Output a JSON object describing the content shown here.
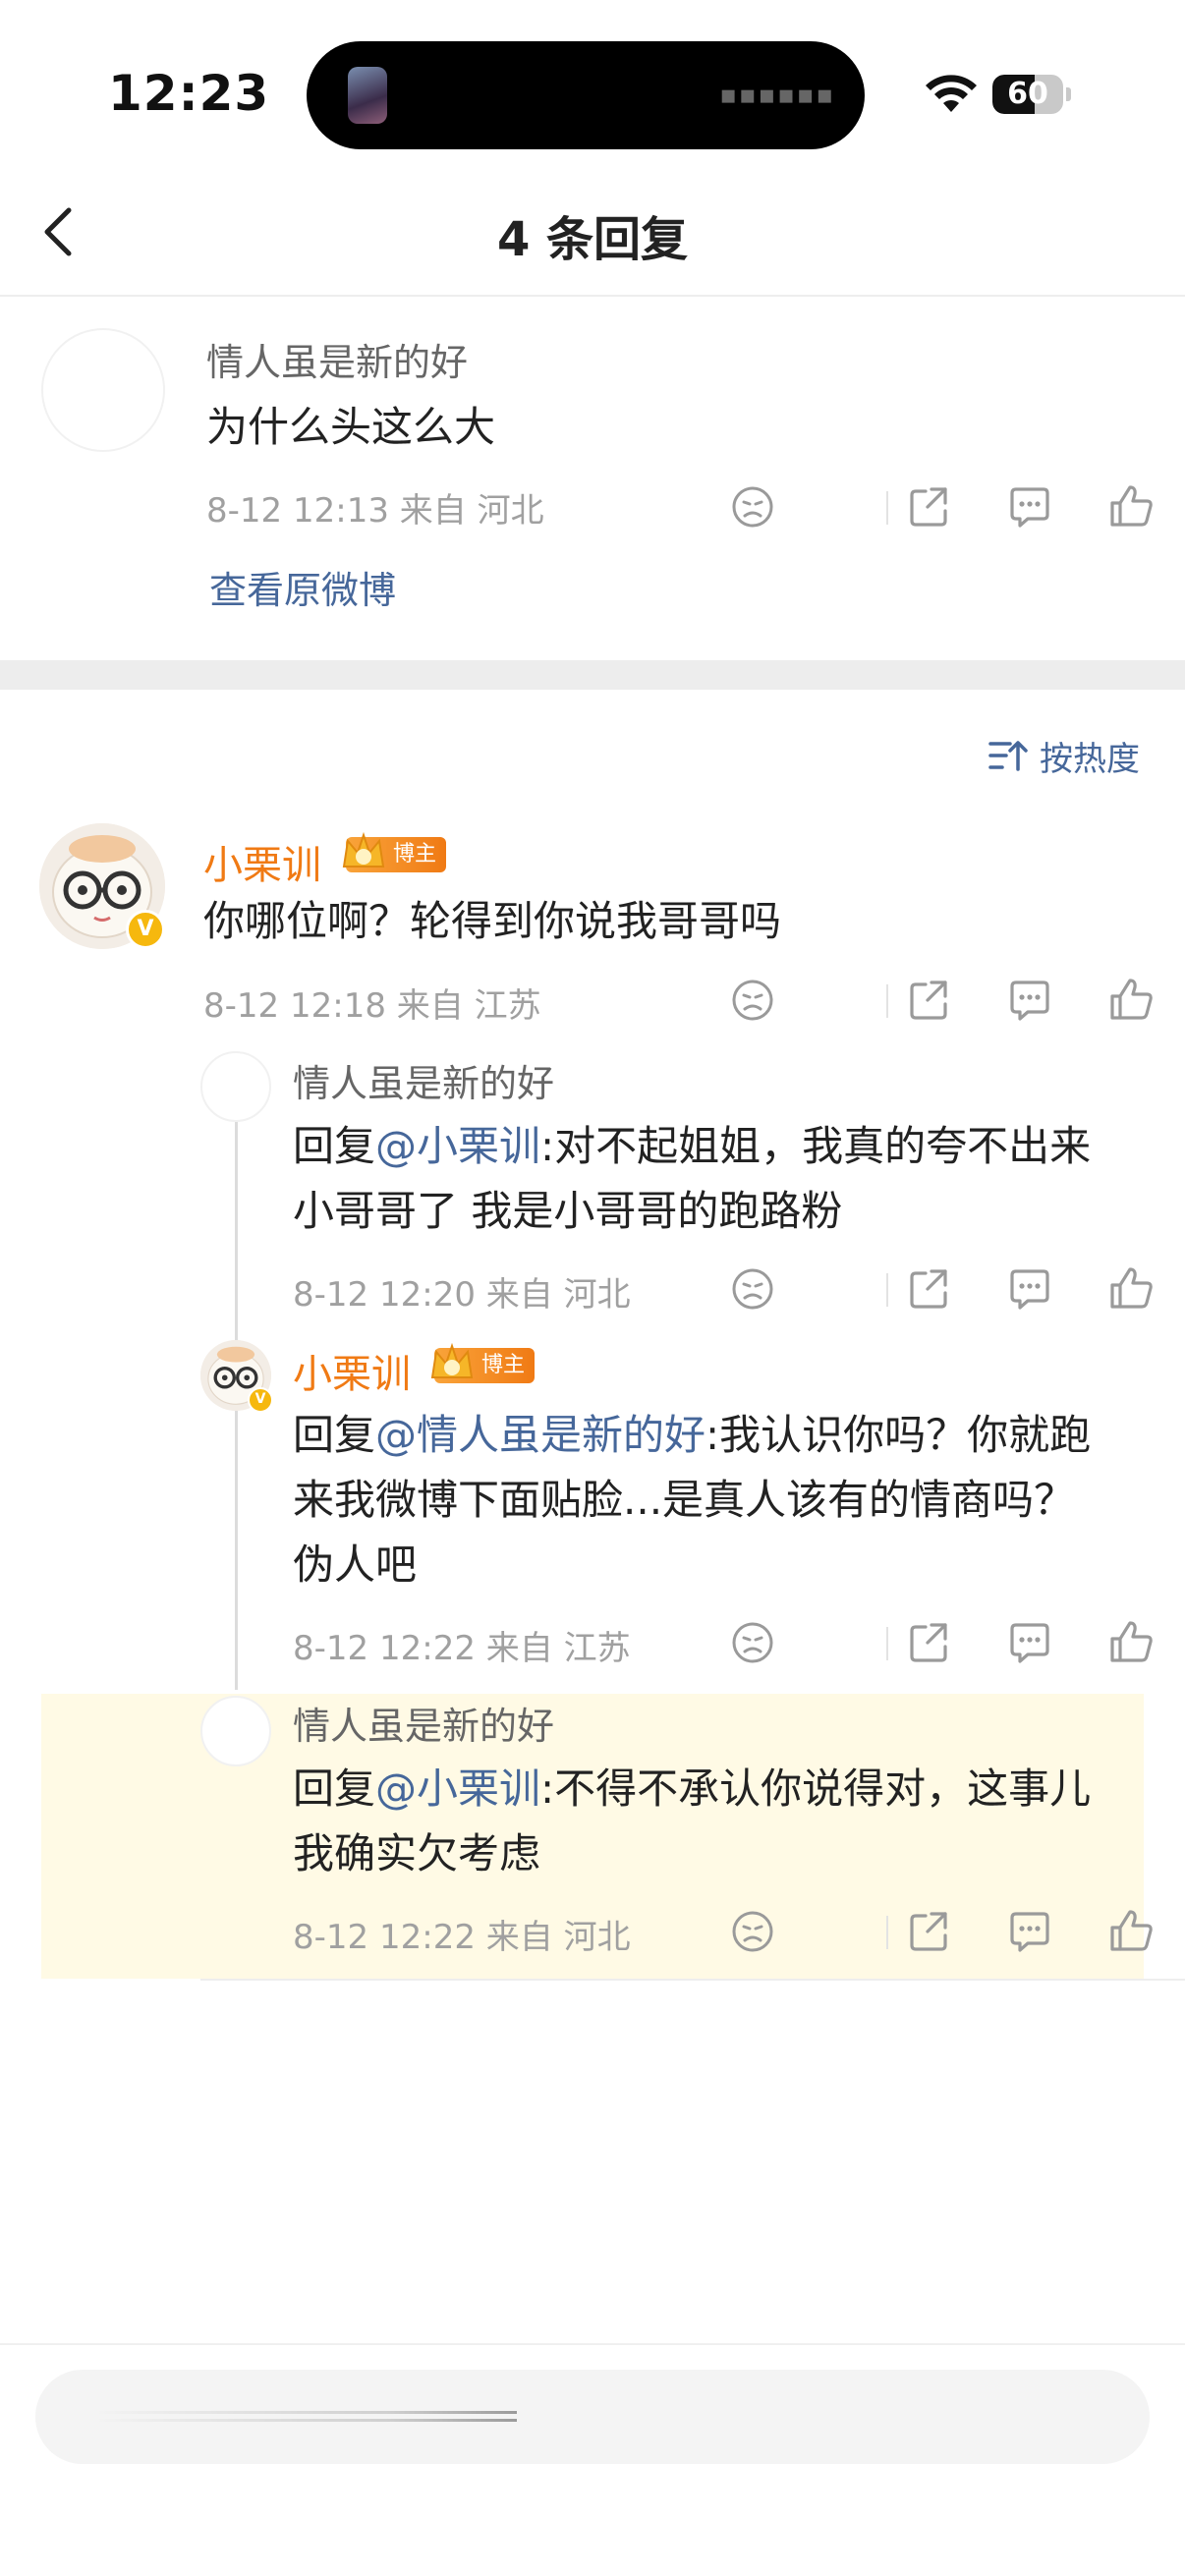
{
  "status_bar": {
    "time": "12:23",
    "battery_level": "60",
    "battery_fraction": 0.6
  },
  "nav": {
    "title": "4 条回复",
    "back_icon": "chevron-left-icon"
  },
  "root_comment": {
    "user": "情人虽是新的好",
    "text": "为什么头这么大",
    "meta": "8-12 12:13  来自 河北",
    "view_original": "查看原微博"
  },
  "sort": {
    "label": "按热度",
    "icon": "sort-icon"
  },
  "main_reply": {
    "user": "小栗训",
    "badge": "博主",
    "verified": "V",
    "text": "你哪位啊？轮得到你说我哥哥吗",
    "meta": "8-12 12:18  来自 江苏"
  },
  "replies": [
    {
      "user": "情人虽是新的好",
      "prefix": "回复",
      "mention": "@小栗训",
      "text_line1": ":对不起姐姐，我真的夸不出来",
      "text_line2": "小哥哥了 我是小哥哥的跑路粉",
      "meta": "8-12 12:20  来自 河北"
    },
    {
      "user": "小栗训",
      "badge": "博主",
      "verified": "V",
      "prefix": "回复",
      "mention": "@情人虽是新的好",
      "text_line1": ":我认识你吗？你就跑",
      "text_line2": "来我微博下面贴脸...是真人该有的情商吗？",
      "text_line3": "伪人吧",
      "meta": "8-12 12:22  来自 江苏"
    },
    {
      "user": "情人虽是新的好",
      "prefix": "回复",
      "mention": "@小栗训",
      "text_line1": ":不得不承认你说得对，这事儿",
      "text_line2": "我确实欠考虑",
      "meta": "8-12 12:22  来自 河北"
    }
  ],
  "action_icons": [
    "dislike-icon",
    "share-icon",
    "comment-icon",
    "like-icon"
  ],
  "colors": {
    "vip_name": "#f07a14",
    "mention": "#46679a",
    "highlight_bg": "#fffae5"
  }
}
